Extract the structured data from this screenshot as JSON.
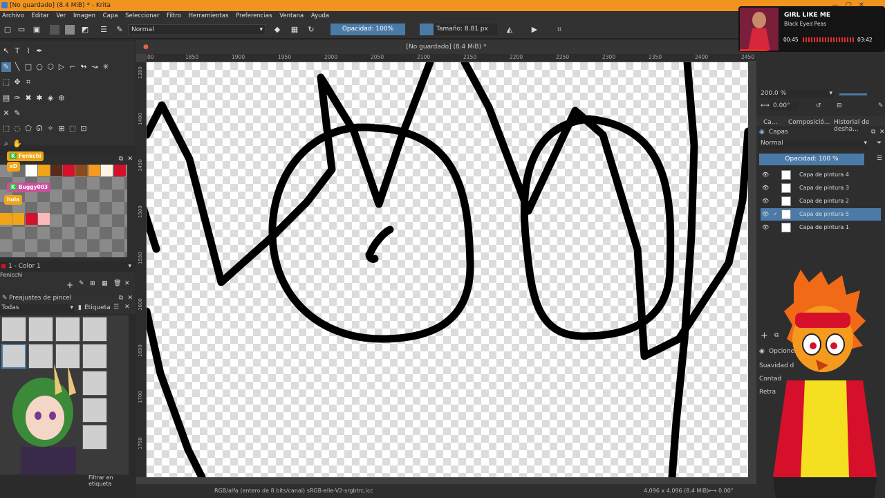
{
  "window": {
    "title": "[No guardado]  (8.4 MiB) * - Krita"
  },
  "menu": [
    "Archivo",
    "Editar",
    "Ver",
    "Imagen",
    "Capa",
    "Seleccionar",
    "Filtro",
    "Herramientas",
    "Preferencias",
    "Ventana",
    "Ayuda"
  ],
  "toolbar": {
    "blend_mode": "Normal",
    "opacity": "Opacidad: 100%",
    "size": "Tamaño: 8.81 px"
  },
  "document": {
    "title": "[No guardado]  (8.4 MiB) *"
  },
  "ruler": {
    "top": [
      "00",
      "1850",
      "1900",
      "1950",
      "2000",
      "2050",
      "2100",
      "2150",
      "2200",
      "2250",
      "2300",
      "2350",
      "2400",
      "2450"
    ],
    "left": [
      "1350",
      "1400",
      "1450",
      "1500",
      "1550",
      "1600",
      "1650",
      "1700",
      "1750"
    ]
  },
  "chat": {
    "messages": [
      {
        "user": "Fenkchi"
      },
      {
        "user": "xD"
      },
      {
        "user": "Buggy003"
      },
      {
        "user": "hola"
      }
    ]
  },
  "palette": {
    "color_selector": "1 - Color 1",
    "label": "Fenicchi"
  },
  "presets": {
    "title": "Preajustes de pincel",
    "filter": "Todas",
    "tag": "Etiqueta",
    "search": "Filtrar en etiqueta"
  },
  "status": {
    "colorspace": "RGB/alfa (entero de 8 bits/canal)  sRGB-elle-V2-srgbtrc.icc",
    "dims": "4,096 x 4,096 (8.4 MiB)",
    "rotation": "0.00°"
  },
  "music": {
    "title": "GIRL LIKE ME",
    "artist": "Black Eyed Peas",
    "elapsed": "00:45",
    "total": "03:42"
  },
  "right": {
    "zoom": "200.0 %",
    "angle": "0.00°",
    "tabs": [
      "Ca...",
      "Composició...",
      "Historial de desha..."
    ],
    "layers_title": "Capas",
    "blend": "Normal",
    "opacity": "Opacidad:  100 %",
    "layers": [
      "Capa de pintura 4",
      "Capa de pintura 3",
      "Capa de pintura 2",
      "Capa de pintura 5",
      "Capa de pintura 1"
    ],
    "options_title": "Opciones de",
    "options": [
      "Suavidad d",
      "Contad",
      "Retra"
    ]
  },
  "colors": {
    "accent": "#f0941e",
    "selection": "#4c7aa6"
  }
}
